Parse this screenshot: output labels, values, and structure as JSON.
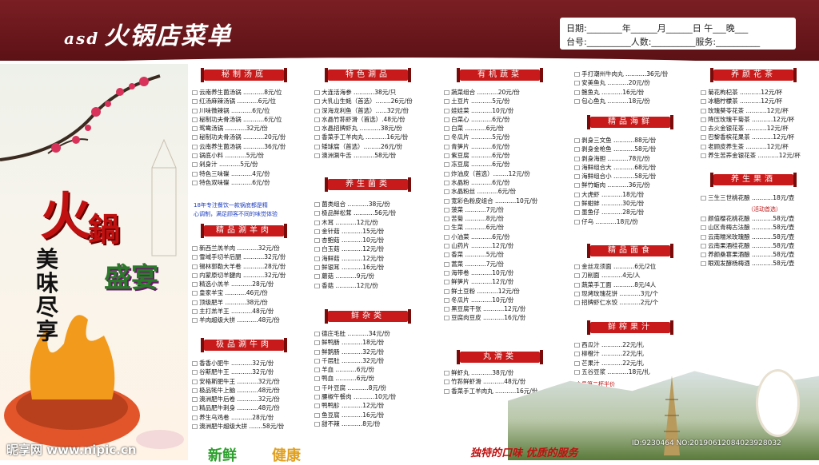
{
  "header": {
    "title_prefix": "asd",
    "title": "火锅店菜单",
    "form_line1": "日期:________年______月______日 午___晚___",
    "form_line2": "台号:__________人数:__________服务:__________"
  },
  "art": {
    "big1": "火",
    "big2": "鍋",
    "v1": "美味尽享",
    "v2": "盛宴",
    "v3": "新鲜",
    "v4": "健康"
  },
  "sections": {
    "s1": "秘制汤底",
    "s2": "精品涮羊肉",
    "s3": "极品涮牛肉",
    "s4": "特色涮品",
    "s5": "养生菌类",
    "s6": "鲜杂类",
    "s7": "有机蔬菜",
    "s8": "丸滑类",
    "s9": "精品海鲜",
    "s10": "精品面食",
    "s11": "鲜榨果汁",
    "s12": "养颜花茶",
    "s13": "养生果酒"
  },
  "col1a": [
    "云南养生菌汤锅 ...........8元/位",
    "红汤麻辣汤锅 ...........6元/位",
    "川味微辣锅 ...........6元/位",
    "秘制功夫骨汤锅 ...........6元/位",
    "鸳鸯汤锅 ...........32元/份",
    "秘制功夫骨汤锅 ...........20元/份",
    "云南养生菌汤锅 ...........36元/份",
    "锅底小料 ...........5元/份",
    "剁身汁 ...........5元/份",
    "特色三味碟 ...........4元/份",
    "特色双味碟 ...........6元/份"
  ],
  "col1note1": "18年专注餐饮一款锅底都是精",
  "col1note2": "心调制，满足顾客不同的味觉体验",
  "col1b": [
    "新西兰羔羊肉 ...........32元/份",
    "雪域手切羊后腿 ...........32元/份",
    "锡林郭勒大羊卷 ...........28元/份",
    "内蒙原切羊腱肉 ...........32元/份",
    "精选小羔羊 ...........28元/份",
    "皇家羊宝 ...........46元/份",
    "顶级肥羊 ...........38元/份",
    "主打羔羊王 ...........48元/份",
    "羊肉超级大拼 ...........48元/份"
  ],
  "col1c": [
    "香香小肥牛 ...........32元/份",
    "谷斯肥牛王 ...........32元/份",
    "安格斯肥牛王 ...........32元/份",
    "极品牦牛上脑 ...........48元/份",
    "澳洲肥牛后卷 ...........32元/份",
    "精品肥牛刺身 ...........48元/份",
    "养生乌鸡卷 ...........28元/份",
    "澳洲肥牛超级大拼 .......58元/份"
  ],
  "col2a": [
    "大连活海参 ...........38元/只",
    "大乳山生蚝（首选）........26元/份",
    "深海龙利鱼（首选）......32元/份",
    "水晶竹荪虾滑（首选）.48元/份",
    "水晶招牌虾丸 ...........38元/份",
    "香菜手工羊肉丸 ...........16元/份",
    "矮球腐（首选）.........26元/份",
    "澳洲涮牛舌 ...........58元/份"
  ],
  "col2b": [
    "菌类组合 ...........38元/份",
    "极品鲜松茸 ...........56元/份",
    "木耳 ...........12元/份",
    "金针菇 ...........15元/份",
    "杏鲍菇 ...........10元/份",
    "白玉菇 ...........12元/份",
    "海鲜菇 ...........12元/份",
    "鲜银耳 ...........16元/份",
    "蘑菇 ...........9元/份",
    "香菇 ...........12元/份"
  ],
  "col2c": [
    "德庄毛肚 ...........34元/份",
    "鲜鸭肠 ...........18元/份",
    "鲜鹅肠 ...........32元/份",
    "千层肚 ...........32元/份",
    "羊血 ...........6元/份",
    "鸭血 ...........6元/份",
    "千叶豆腐 ...........8元/份",
    "腰椒午餐肉 ...........10元/份",
    "鸭鸭胗 ...........12元/份",
    "鱼豆腐 ...........16元/份",
    "甜不辣 ...........8元/份"
  ],
  "col3a": [
    "蔬菜组合 ...........20元/份",
    "土豆片 ...........5元/份",
    "娃娃菜 ...........10元/份",
    "白菜心 ...........6元/份",
    "白菜 ...........6元/份",
    "冬瓜片 ...........5元/份",
    "青笋片 ...........6元/份",
    "紫豆腐 ...........6元/份",
    "冻豆腐 ...........6元/份",
    "炸油皮（首选）........12元/份",
    "水晶粉 ...........6元/份",
    "水晶粉丝 ...........6元/份",
    "宽彩色粉皮组合 ...........10元/份",
    "菠菜 ...........7元/份",
    "苦菊 ...........8元/份",
    "生菜 ...........6元/份",
    "小油菜 ...........6元/份",
    "山药片 ...........12元/份",
    "香菜 ...........5元/份",
    "蒿菜 ...........7元/份",
    "海带卷 ...........10元/份",
    "鲜笋片 ...........12元/份",
    "鲜土豆粉 ...........12元/份",
    "冬瓜片 ...........10元/份",
    "黑豆腐干张 ...........12元/份",
    "豆腐肉豆皮 ...........16元/份"
  ],
  "col3b": [
    "鲜虾丸 ...........38元/份",
    "竹荪鲜虾滑 ...........48元/份",
    "香菜手工羊肉丸 ...........16元/份"
  ],
  "col4a": [
    "手打潮州牛肉丸 ...........36元/份",
    "安美鱼丸 ...........20元/份",
    "鲍鱼丸 ...........16元/份",
    "包心鱼丸 ...........18元/份"
  ],
  "col4b": [
    "剥身三文鱼 ...........88元/份",
    "剥身金枪鱼 ...........58元/份",
    "剥身海胆 ...........78元/份",
    "海鲜组合大 ...........68元/份",
    "海鲜组合小 ...........58元/份",
    "鲜竹蛎肉 ...........36元/份",
    "大虎虾 ...........18元/份",
    "鲜蚶蚌 ...........30元/份",
    "墨鱼仔 ...........28元/份",
    "仔乌 ...........18元/份"
  ],
  "col4c": [
    "金丝龙须面 ...........6元/2位",
    "刀削面 ...........4元/人",
    "蔬菜手工面 ...........8元/4人",
    "现烤玫瑰花饼 ...........3元/个",
    "招牌虾仁水饺 ...........2元/个"
  ],
  "col4d": [
    "西瓜汁 ...........22元/扎",
    "柳橙汁 ...........22元/扎",
    "芒果汁 ...........22元/扎",
    "五谷豆浆 ...........18元/扎"
  ],
  "col4note": "会员第二杯半价",
  "col5a": [
    "菊花枸杞茶 ...........12元/杯",
    "冰糖柠檬茶 ...........12元/杯",
    "玫瑰葵苓花茶 ...........12元/杯",
    "降压玫瑰干菊茶 ...........12元/杯",
    "去火金银花茶 ...........12元/杯",
    "巴黎香槟花果茶 ...........12元/杯",
    "老顾皮养生茶 ...........12元/杯",
    "养生苦荞金银花茶 ...........12元/杯"
  ],
  "col5b": [
    "三生三世桃花酿 ...........18元/壶"
  ],
  "col5note": "（活动首选）",
  "col5c": [
    "颜值樱花桃花酿 ...........58元/壶",
    "山区青梅古法酿 ...........58元/壶",
    "云南糯米玫瑰酿 ...........58元/壶",
    "云南果酒桂花酿 ...........58元/壶",
    "养颜桑葚果酒酿 ...........58元/壶",
    "眼观发酵杨梅酒 ...........58元/壶"
  ],
  "footer": {
    "slogan": "独特的口味 优质的服务",
    "wm_left": "昵享网 www.nipic.cn",
    "wm_right": "ID:9230464 NO:20190612084023928032"
  }
}
